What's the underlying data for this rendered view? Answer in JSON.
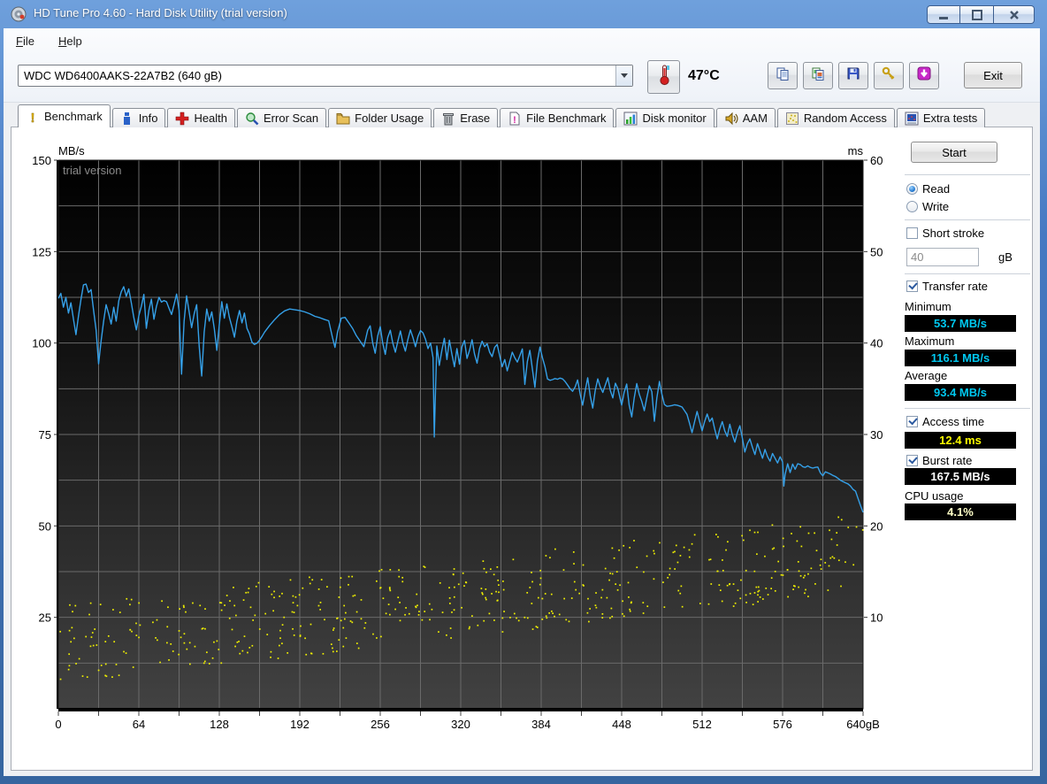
{
  "window": {
    "title": "HD Tune Pro 4.60 - Hard Disk Utility (trial version)",
    "controls": [
      "minimize",
      "maximize",
      "close"
    ]
  },
  "menu": {
    "items": [
      "File",
      "Help"
    ]
  },
  "toolbar": {
    "drive_selector_value": "WDC WD6400AAKS-22A7B2 (640 gB)",
    "temperature": "47°C",
    "buttons": [
      {
        "name": "copy-text-button",
        "icon": "copy-icon"
      },
      {
        "name": "copy-image-button",
        "icon": "copy-image-icon"
      },
      {
        "name": "save-button",
        "icon": "save-icon"
      },
      {
        "name": "options-button",
        "icon": "settings-icon"
      },
      {
        "name": "update-button",
        "icon": "download-icon"
      }
    ],
    "exit_label": "Exit"
  },
  "tabs": [
    {
      "label": "Benchmark",
      "icon": "benchmark-icon",
      "active": true
    },
    {
      "label": "Info",
      "icon": "info-icon",
      "active": false
    },
    {
      "label": "Health",
      "icon": "health-icon",
      "active": false
    },
    {
      "label": "Error Scan",
      "icon": "error-scan-icon",
      "active": false
    },
    {
      "label": "Folder Usage",
      "icon": "folder-usage-icon",
      "active": false
    },
    {
      "label": "Erase",
      "icon": "erase-icon",
      "active": false
    },
    {
      "label": "File Benchmark",
      "icon": "file-benchmark-icon",
      "active": false
    },
    {
      "label": "Disk monitor",
      "icon": "disk-monitor-icon",
      "active": false
    },
    {
      "label": "AAM",
      "icon": "aam-icon",
      "active": false
    },
    {
      "label": "Random Access",
      "icon": "random-access-icon",
      "active": false
    },
    {
      "label": "Extra tests",
      "icon": "extra-tests-icon",
      "active": false
    }
  ],
  "panel": {
    "start_label": "Start",
    "read_label": "Read",
    "write_label": "Write",
    "short_stroke_label": "Short stroke",
    "short_stroke_value": "40",
    "short_stroke_unit": "gB",
    "transfer_rate_label": "Transfer rate",
    "minimum_label": "Minimum",
    "minimum_value": "53.7 MB/s",
    "maximum_label": "Maximum",
    "maximum_value": "116.1 MB/s",
    "average_label": "Average",
    "average_value": "93.4 MB/s",
    "access_time_label": "Access time",
    "access_time_value": "12.4 ms",
    "burst_rate_label": "Burst rate",
    "burst_rate_value": "167.5 MB/s",
    "cpu_usage_label": "CPU usage",
    "cpu_usage_value": "4.1%"
  },
  "chart_data": {
    "type": "line+scatter",
    "watermark": "trial version",
    "left_axis": {
      "label": "MB/s",
      "range": [
        0,
        150
      ],
      "ticks": [
        150,
        125,
        100,
        75,
        50,
        25
      ]
    },
    "right_axis": {
      "label": "ms",
      "range": [
        0,
        60
      ],
      "ticks": [
        60,
        50,
        40,
        30,
        20,
        10
      ]
    },
    "x_axis": {
      "range": [
        0,
        640
      ],
      "tick_step": 64,
      "grid_step": 32,
      "ticks": [
        "0",
        "64",
        "128",
        "192",
        "256",
        "320",
        "384",
        "448",
        "512",
        "576",
        "640gB"
      ]
    },
    "grid": true,
    "colors": {
      "transfer_line": "#35a0e8",
      "access_dots": "#f0f000",
      "grid": "#6a6a6a",
      "watermark": "#8a8a8a"
    },
    "stats": {
      "minimum_mbps": 53.7,
      "maximum_mbps": 116.1,
      "average_mbps": 93.4,
      "access_time_ms": 12.4
    },
    "transfer_rate_mbps": [
      [
        0,
        112.2
      ],
      [
        2,
        113.6
      ],
      [
        4,
        109.8
      ],
      [
        6,
        112.5
      ],
      [
        8,
        108.2
      ],
      [
        10,
        111
      ],
      [
        12,
        106.5
      ],
      [
        14,
        102.3
      ],
      [
        16,
        107.5
      ],
      [
        18,
        112
      ],
      [
        20,
        115.9
      ],
      [
        22,
        116.1
      ],
      [
        24,
        113.8
      ],
      [
        26,
        114.6
      ],
      [
        28,
        109
      ],
      [
        30,
        103.5
      ],
      [
        32,
        94.3
      ],
      [
        34,
        100.5
      ],
      [
        36,
        106
      ],
      [
        38,
        110.5
      ],
      [
        40,
        108
      ],
      [
        42,
        105.2
      ],
      [
        44,
        109.8
      ],
      [
        46,
        106
      ],
      [
        48,
        111.5
      ],
      [
        50,
        114
      ],
      [
        52,
        115.4
      ],
      [
        54,
        112.8
      ],
      [
        56,
        114.8
      ],
      [
        58,
        111
      ],
      [
        60,
        107
      ],
      [
        62,
        103.6
      ],
      [
        64,
        107.5
      ],
      [
        66,
        110
      ],
      [
        68,
        113.3
      ],
      [
        70,
        104
      ],
      [
        72,
        109
      ],
      [
        74,
        112
      ],
      [
        76,
        106.5
      ],
      [
        78,
        110
      ],
      [
        80,
        112.5
      ],
      [
        82,
        111.2
      ],
      [
        84,
        111.6
      ],
      [
        86,
        111.3
      ],
      [
        88,
        109.5
      ],
      [
        90,
        107.8
      ],
      [
        92,
        110.5
      ],
      [
        94,
        113.4
      ],
      [
        96,
        109
      ],
      [
        98,
        91.5
      ],
      [
        100,
        106
      ],
      [
        102,
        112.9
      ],
      [
        104,
        108.5
      ],
      [
        106,
        104.2
      ],
      [
        108,
        108
      ],
      [
        110,
        110.5
      ],
      [
        112,
        99
      ],
      [
        114,
        91
      ],
      [
        116,
        103
      ],
      [
        118,
        109.3
      ],
      [
        120,
        106
      ],
      [
        122,
        108.5
      ],
      [
        124,
        104
      ],
      [
        126,
        98
      ],
      [
        128,
        105
      ],
      [
        130,
        111.3
      ],
      [
        132,
        106.8
      ],
      [
        134,
        110.7
      ],
      [
        136,
        107
      ],
      [
        138,
        104.5
      ],
      [
        140,
        101.6
      ],
      [
        142,
        106
      ],
      [
        144,
        108.9
      ],
      [
        146,
        105.5
      ],
      [
        148,
        108.2
      ],
      [
        150,
        104
      ],
      [
        152,
        102.5
      ],
      [
        154,
        100.2
      ],
      [
        156,
        99.6
      ],
      [
        158,
        100
      ],
      [
        160,
        100.8
      ],
      [
        162,
        101.8
      ],
      [
        164,
        103
      ],
      [
        168,
        104.8
      ],
      [
        172,
        106.4
      ],
      [
        176,
        107.8
      ],
      [
        180,
        108.8
      ],
      [
        184,
        109.3
      ],
      [
        188,
        109.1
      ],
      [
        192,
        108.9
      ],
      [
        196,
        108.5
      ],
      [
        200,
        108
      ],
      [
        204,
        107.3
      ],
      [
        208,
        106.9
      ],
      [
        212,
        106.4
      ],
      [
        215,
        106.1
      ],
      [
        218,
        101.5
      ],
      [
        220,
        98.8
      ],
      [
        222,
        103
      ],
      [
        225,
        106.8
      ],
      [
        228,
        107
      ],
      [
        231,
        105.5
      ],
      [
        234,
        104
      ],
      [
        237,
        102
      ],
      [
        240,
        100.5
      ],
      [
        243,
        99
      ],
      [
        246,
        103.5
      ],
      [
        248,
        104.7
      ],
      [
        250,
        100
      ],
      [
        252,
        97.2
      ],
      [
        254,
        102
      ],
      [
        256,
        104.5
      ],
      [
        258,
        100
      ],
      [
        260,
        96.9
      ],
      [
        262,
        101.5
      ],
      [
        264,
        103.5
      ],
      [
        266,
        100
      ],
      [
        268,
        97.5
      ],
      [
        270,
        100.5
      ],
      [
        272,
        103.3
      ],
      [
        274,
        100
      ],
      [
        276,
        97.8
      ],
      [
        278,
        101
      ],
      [
        280,
        103.6
      ],
      [
        282,
        101.5
      ],
      [
        284,
        99
      ],
      [
        286,
        101.8
      ],
      [
        288,
        103.4
      ],
      [
        290,
        102.8
      ],
      [
        292,
        101
      ],
      [
        294,
        98.5
      ],
      [
        296,
        100
      ],
      [
        298,
        96
      ],
      [
        299,
        74.3
      ],
      [
        300,
        88
      ],
      [
        301,
        99.2
      ],
      [
        303,
        93.9
      ],
      [
        305,
        98
      ],
      [
        307,
        101.3
      ],
      [
        309,
        95.5
      ],
      [
        311,
        100.8
      ],
      [
        313,
        97
      ],
      [
        315,
        93.5
      ],
      [
        317,
        98.5
      ],
      [
        319,
        94.2
      ],
      [
        321,
        99
      ],
      [
        323,
        100.7
      ],
      [
        325,
        95.8
      ],
      [
        327,
        98
      ],
      [
        329,
        100.9
      ],
      [
        331,
        97
      ],
      [
        333,
        94.5
      ],
      [
        335,
        98.5
      ],
      [
        337,
        100.5
      ],
      [
        339,
        99
      ],
      [
        341,
        99.8
      ],
      [
        343,
        97.5
      ],
      [
        345,
        96.3
      ],
      [
        347,
        98.8
      ],
      [
        349,
        99.6
      ],
      [
        351,
        96.5
      ],
      [
        353,
        93.5
      ],
      [
        355,
        95.5
      ],
      [
        357,
        92.4
      ],
      [
        359,
        95
      ],
      [
        361,
        97.5
      ],
      [
        363,
        96
      ],
      [
        365,
        94.8
      ],
      [
        367,
        96.5
      ],
      [
        369,
        98.4
      ],
      [
        371,
        88.7
      ],
      [
        373,
        95
      ],
      [
        375,
        98
      ],
      [
        377,
        93
      ],
      [
        379,
        87.9
      ],
      [
        381,
        95
      ],
      [
        383,
        98.9
      ],
      [
        385,
        96
      ],
      [
        387,
        93.5
      ],
      [
        389,
        90.2
      ],
      [
        391,
        89.8
      ],
      [
        393,
        90
      ],
      [
        395,
        90.3
      ],
      [
        397,
        90.1
      ],
      [
        399,
        90.4
      ],
      [
        401,
        90.2
      ],
      [
        403,
        89.5
      ],
      [
        405,
        88.5
      ],
      [
        407,
        87.5
      ],
      [
        409,
        86.8
      ],
      [
        411,
        88
      ],
      [
        413,
        89.9
      ],
      [
        415,
        86
      ],
      [
        417,
        83
      ],
      [
        419,
        87
      ],
      [
        421,
        90.5
      ],
      [
        423,
        85.5
      ],
      [
        425,
        82.2
      ],
      [
        427,
        87
      ],
      [
        429,
        90.2
      ],
      [
        431,
        88
      ],
      [
        433,
        86.5
      ],
      [
        435,
        88.5
      ],
      [
        437,
        90.5
      ],
      [
        439,
        87
      ],
      [
        441,
        85
      ],
      [
        443,
        89
      ],
      [
        445,
        87.5
      ],
      [
        447,
        84.5
      ],
      [
        448,
        83
      ],
      [
        450,
        86.5
      ],
      [
        452,
        88.8
      ],
      [
        454,
        83
      ],
      [
        456,
        79.8
      ],
      [
        458,
        85
      ],
      [
        460,
        88.9
      ],
      [
        462,
        86
      ],
      [
        464,
        84
      ],
      [
        466,
        81.5
      ],
      [
        468,
        85
      ],
      [
        470,
        88.3
      ],
      [
        472,
        86.7
      ],
      [
        474,
        78.6
      ],
      [
        476,
        85
      ],
      [
        478,
        89.5
      ],
      [
        480,
        86
      ],
      [
        482,
        83.2
      ],
      [
        484,
        82.7
      ],
      [
        486,
        82.8
      ],
      [
        488,
        82.9
      ],
      [
        490,
        83.1
      ],
      [
        492,
        83
      ],
      [
        494,
        82.8
      ],
      [
        496,
        82.5
      ],
      [
        498,
        81.5
      ],
      [
        500,
        80.5
      ],
      [
        502,
        78
      ],
      [
        504,
        75.5
      ],
      [
        506,
        78.5
      ],
      [
        508,
        81.3
      ],
      [
        510,
        78.5
      ],
      [
        512,
        76
      ],
      [
        514,
        78.5
      ],
      [
        516,
        80.6
      ],
      [
        518,
        78.5
      ],
      [
        520,
        79.5
      ],
      [
        522,
        76.5
      ],
      [
        524,
        73.8
      ],
      [
        526,
        76.5
      ],
      [
        528,
        78.5
      ],
      [
        530,
        76
      ],
      [
        532,
        74.5
      ],
      [
        534,
        77.8
      ],
      [
        536,
        75
      ],
      [
        538,
        72.9
      ],
      [
        540,
        75.5
      ],
      [
        542,
        77.4
      ],
      [
        544,
        74
      ],
      [
        546,
        70.2
      ],
      [
        548,
        72.5
      ],
      [
        550,
        73.8
      ],
      [
        552,
        71.5
      ],
      [
        554,
        69.5
      ],
      [
        556,
        72.5
      ],
      [
        558,
        70.5
      ],
      [
        560,
        68.5
      ],
      [
        562,
        70.9
      ],
      [
        564,
        69
      ],
      [
        566,
        67.7
      ],
      [
        568,
        69.8
      ],
      [
        570,
        68.5
      ],
      [
        572,
        67.2
      ],
      [
        574,
        68.9
      ],
      [
        576,
        67.5
      ],
      [
        577,
        60.9
      ],
      [
        578,
        64
      ],
      [
        580,
        67
      ],
      [
        582,
        64.6
      ],
      [
        584,
        66.9
      ],
      [
        586,
        65.5
      ],
      [
        588,
        67
      ],
      [
        590,
        66.8
      ],
      [
        592,
        66.2
      ],
      [
        594,
        66
      ],
      [
        596,
        66.4
      ],
      [
        598,
        66
      ],
      [
        600,
        65.8
      ],
      [
        602,
        66
      ],
      [
        604,
        66.1
      ],
      [
        606,
        64.5
      ],
      [
        608,
        63.7
      ],
      [
        610,
        64.8
      ],
      [
        612,
        64.5
      ],
      [
        614,
        64.2
      ],
      [
        616,
        63.8
      ],
      [
        618,
        63.5
      ],
      [
        620,
        63
      ],
      [
        622,
        62.5
      ],
      [
        624,
        62.1
      ],
      [
        626,
        61.8
      ],
      [
        628,
        61.5
      ],
      [
        630,
        60.9
      ],
      [
        632,
        60
      ],
      [
        634,
        59.5
      ],
      [
        636,
        57.5
      ],
      [
        638,
        55.5
      ],
      [
        640,
        53.7
      ]
    ],
    "access_time_scatter": {
      "count": 520,
      "seed": 1337,
      "center_start_ms": 7.0,
      "center_end_ms": 17.0,
      "spread_ms": 4.3,
      "min_ms": 2.8,
      "max_ms": 22.5
    }
  }
}
